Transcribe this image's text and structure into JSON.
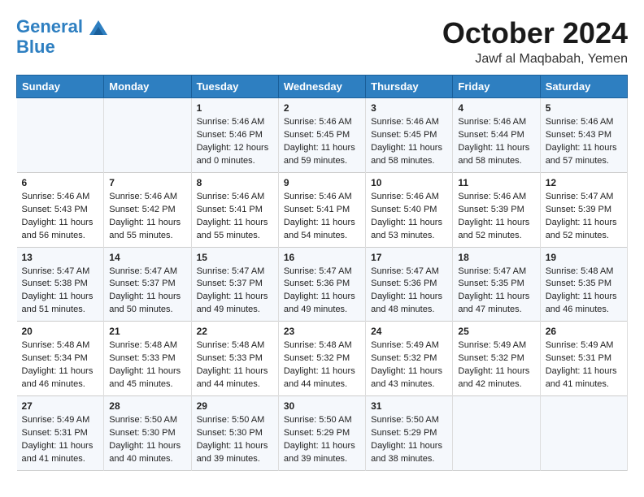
{
  "logo": {
    "line1": "General",
    "line2": "Blue"
  },
  "title": "October 2024",
  "location": "Jawf al Maqbabah, Yemen",
  "days_of_week": [
    "Sunday",
    "Monday",
    "Tuesday",
    "Wednesday",
    "Thursday",
    "Friday",
    "Saturday"
  ],
  "weeks": [
    [
      {
        "day": "",
        "content": ""
      },
      {
        "day": "",
        "content": ""
      },
      {
        "day": "1",
        "content": "Sunrise: 5:46 AM\nSunset: 5:46 PM\nDaylight: 12 hours\nand 0 minutes."
      },
      {
        "day": "2",
        "content": "Sunrise: 5:46 AM\nSunset: 5:45 PM\nDaylight: 11 hours\nand 59 minutes."
      },
      {
        "day": "3",
        "content": "Sunrise: 5:46 AM\nSunset: 5:45 PM\nDaylight: 11 hours\nand 58 minutes."
      },
      {
        "day": "4",
        "content": "Sunrise: 5:46 AM\nSunset: 5:44 PM\nDaylight: 11 hours\nand 58 minutes."
      },
      {
        "day": "5",
        "content": "Sunrise: 5:46 AM\nSunset: 5:43 PM\nDaylight: 11 hours\nand 57 minutes."
      }
    ],
    [
      {
        "day": "6",
        "content": "Sunrise: 5:46 AM\nSunset: 5:43 PM\nDaylight: 11 hours\nand 56 minutes."
      },
      {
        "day": "7",
        "content": "Sunrise: 5:46 AM\nSunset: 5:42 PM\nDaylight: 11 hours\nand 55 minutes."
      },
      {
        "day": "8",
        "content": "Sunrise: 5:46 AM\nSunset: 5:41 PM\nDaylight: 11 hours\nand 55 minutes."
      },
      {
        "day": "9",
        "content": "Sunrise: 5:46 AM\nSunset: 5:41 PM\nDaylight: 11 hours\nand 54 minutes."
      },
      {
        "day": "10",
        "content": "Sunrise: 5:46 AM\nSunset: 5:40 PM\nDaylight: 11 hours\nand 53 minutes."
      },
      {
        "day": "11",
        "content": "Sunrise: 5:46 AM\nSunset: 5:39 PM\nDaylight: 11 hours\nand 52 minutes."
      },
      {
        "day": "12",
        "content": "Sunrise: 5:47 AM\nSunset: 5:39 PM\nDaylight: 11 hours\nand 52 minutes."
      }
    ],
    [
      {
        "day": "13",
        "content": "Sunrise: 5:47 AM\nSunset: 5:38 PM\nDaylight: 11 hours\nand 51 minutes."
      },
      {
        "day": "14",
        "content": "Sunrise: 5:47 AM\nSunset: 5:37 PM\nDaylight: 11 hours\nand 50 minutes."
      },
      {
        "day": "15",
        "content": "Sunrise: 5:47 AM\nSunset: 5:37 PM\nDaylight: 11 hours\nand 49 minutes."
      },
      {
        "day": "16",
        "content": "Sunrise: 5:47 AM\nSunset: 5:36 PM\nDaylight: 11 hours\nand 49 minutes."
      },
      {
        "day": "17",
        "content": "Sunrise: 5:47 AM\nSunset: 5:36 PM\nDaylight: 11 hours\nand 48 minutes."
      },
      {
        "day": "18",
        "content": "Sunrise: 5:47 AM\nSunset: 5:35 PM\nDaylight: 11 hours\nand 47 minutes."
      },
      {
        "day": "19",
        "content": "Sunrise: 5:48 AM\nSunset: 5:35 PM\nDaylight: 11 hours\nand 46 minutes."
      }
    ],
    [
      {
        "day": "20",
        "content": "Sunrise: 5:48 AM\nSunset: 5:34 PM\nDaylight: 11 hours\nand 46 minutes."
      },
      {
        "day": "21",
        "content": "Sunrise: 5:48 AM\nSunset: 5:33 PM\nDaylight: 11 hours\nand 45 minutes."
      },
      {
        "day": "22",
        "content": "Sunrise: 5:48 AM\nSunset: 5:33 PM\nDaylight: 11 hours\nand 44 minutes."
      },
      {
        "day": "23",
        "content": "Sunrise: 5:48 AM\nSunset: 5:32 PM\nDaylight: 11 hours\nand 44 minutes."
      },
      {
        "day": "24",
        "content": "Sunrise: 5:49 AM\nSunset: 5:32 PM\nDaylight: 11 hours\nand 43 minutes."
      },
      {
        "day": "25",
        "content": "Sunrise: 5:49 AM\nSunset: 5:32 PM\nDaylight: 11 hours\nand 42 minutes."
      },
      {
        "day": "26",
        "content": "Sunrise: 5:49 AM\nSunset: 5:31 PM\nDaylight: 11 hours\nand 41 minutes."
      }
    ],
    [
      {
        "day": "27",
        "content": "Sunrise: 5:49 AM\nSunset: 5:31 PM\nDaylight: 11 hours\nand 41 minutes."
      },
      {
        "day": "28",
        "content": "Sunrise: 5:50 AM\nSunset: 5:30 PM\nDaylight: 11 hours\nand 40 minutes."
      },
      {
        "day": "29",
        "content": "Sunrise: 5:50 AM\nSunset: 5:30 PM\nDaylight: 11 hours\nand 39 minutes."
      },
      {
        "day": "30",
        "content": "Sunrise: 5:50 AM\nSunset: 5:29 PM\nDaylight: 11 hours\nand 39 minutes."
      },
      {
        "day": "31",
        "content": "Sunrise: 5:50 AM\nSunset: 5:29 PM\nDaylight: 11 hours\nand 38 minutes."
      },
      {
        "day": "",
        "content": ""
      },
      {
        "day": "",
        "content": ""
      }
    ]
  ]
}
